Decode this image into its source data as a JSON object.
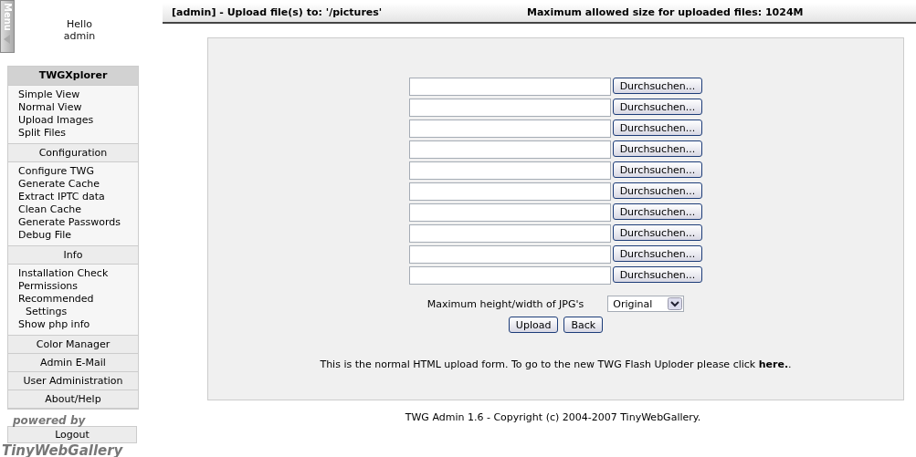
{
  "menu_tab": {
    "label": "Menu"
  },
  "greeting": [
    "Hello",
    "admin"
  ],
  "sidebar": {
    "sections": [
      {
        "title": "TWGXplorer",
        "bold": true,
        "items": [
          "Simple View",
          "Normal View",
          "Upload Images",
          "Split Files"
        ]
      },
      {
        "title": "Configuration",
        "bold": false,
        "items": [
          "Configure TWG",
          "Generate Cache",
          "Extract IPTC data",
          "Clean Cache",
          "Generate Passwords",
          "Debug File"
        ]
      },
      {
        "title": "Info",
        "bold": false,
        "items": [
          "Installation Check",
          "Permissions",
          "Recommended\nSettings",
          "Show php info"
        ]
      },
      {
        "title": "Color Manager",
        "bold": false
      },
      {
        "title": "Admin E-Mail",
        "bold": false
      },
      {
        "title": "User Administration",
        "bold": false
      },
      {
        "title": "About/Help",
        "bold": false
      }
    ],
    "powered_by": [
      "powered by",
      "TinyWebGallery"
    ],
    "logout": "Logout"
  },
  "header": {
    "title": "[admin] - Upload file(s) to: '/pictures'",
    "limit": "Maximum allowed size for uploaded files: 1024M"
  },
  "file_inputs": [
    {
      "button": "Durchsuchen..."
    },
    {
      "button": "Durchsuchen..."
    },
    {
      "button": "Durchsuchen..."
    },
    {
      "button": "Durchsuchen..."
    },
    {
      "button": "Durchsuchen..."
    },
    {
      "button": "Durchsuchen..."
    },
    {
      "button": "Durchsuchen..."
    },
    {
      "button": "Durchsuchen..."
    },
    {
      "button": "Durchsuchen..."
    },
    {
      "button": "Durchsuchen..."
    }
  ],
  "size_select": {
    "label": "Maximum height/width of JPG's",
    "value": "Original"
  },
  "buttons": [
    "Upload",
    "Back"
  ],
  "note": {
    "text": "This is the normal HTML upload form. To go to the new TWG Flash Uploder please click ",
    "link": "here.",
    "after": "."
  },
  "footer": "TWG Admin 1.6 - Copyright (c) 2004-2007 TinyWebGallery."
}
